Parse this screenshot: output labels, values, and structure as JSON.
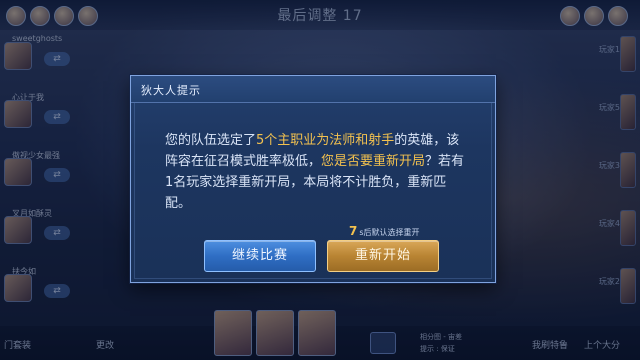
{
  "header": {
    "round_title": "最后调整 17"
  },
  "left_players": [
    {
      "name": "sweetghosts"
    },
    {
      "name": "心让于我"
    },
    {
      "name": "傲视少女最强"
    },
    {
      "name": "叉月如酥灵"
    },
    {
      "name": "扶今如"
    }
  ],
  "right_players": [
    {
      "name": "玩家1"
    },
    {
      "name": "玩家5"
    },
    {
      "name": "玩家3"
    },
    {
      "name": "玩家4"
    },
    {
      "name": "玩家2"
    }
  ],
  "bottom": {
    "left_label": "门套装",
    "change_label": "更改",
    "hint_line1": "相分图 - 宙差",
    "hint_line2": "提示 : 保证",
    "lineup_label": "我刷特鲁",
    "exit_label": "上个大分"
  },
  "dialog": {
    "title": "狄大人提示",
    "body": {
      "p1": "您的队伍选定了",
      "p2": "5个主职业为法师和射手",
      "p3": "的英雄，该阵容在征召模式胜率极低，",
      "p4": "您是否要重新开局",
      "p5": "？若有1名玩家选择重新开局，本局将不计胜负，重新匹配。"
    },
    "countdown_value": "7",
    "countdown_unit": "s",
    "countdown_text": "后默认选择重开",
    "continue_label": "继续比赛",
    "restart_label": "重新开始"
  },
  "colors": {
    "highlight": "#f2c14f",
    "continue_button": "#2f6ec4",
    "restart_button": "#b98433",
    "dialog_bg": "#1d3660"
  }
}
